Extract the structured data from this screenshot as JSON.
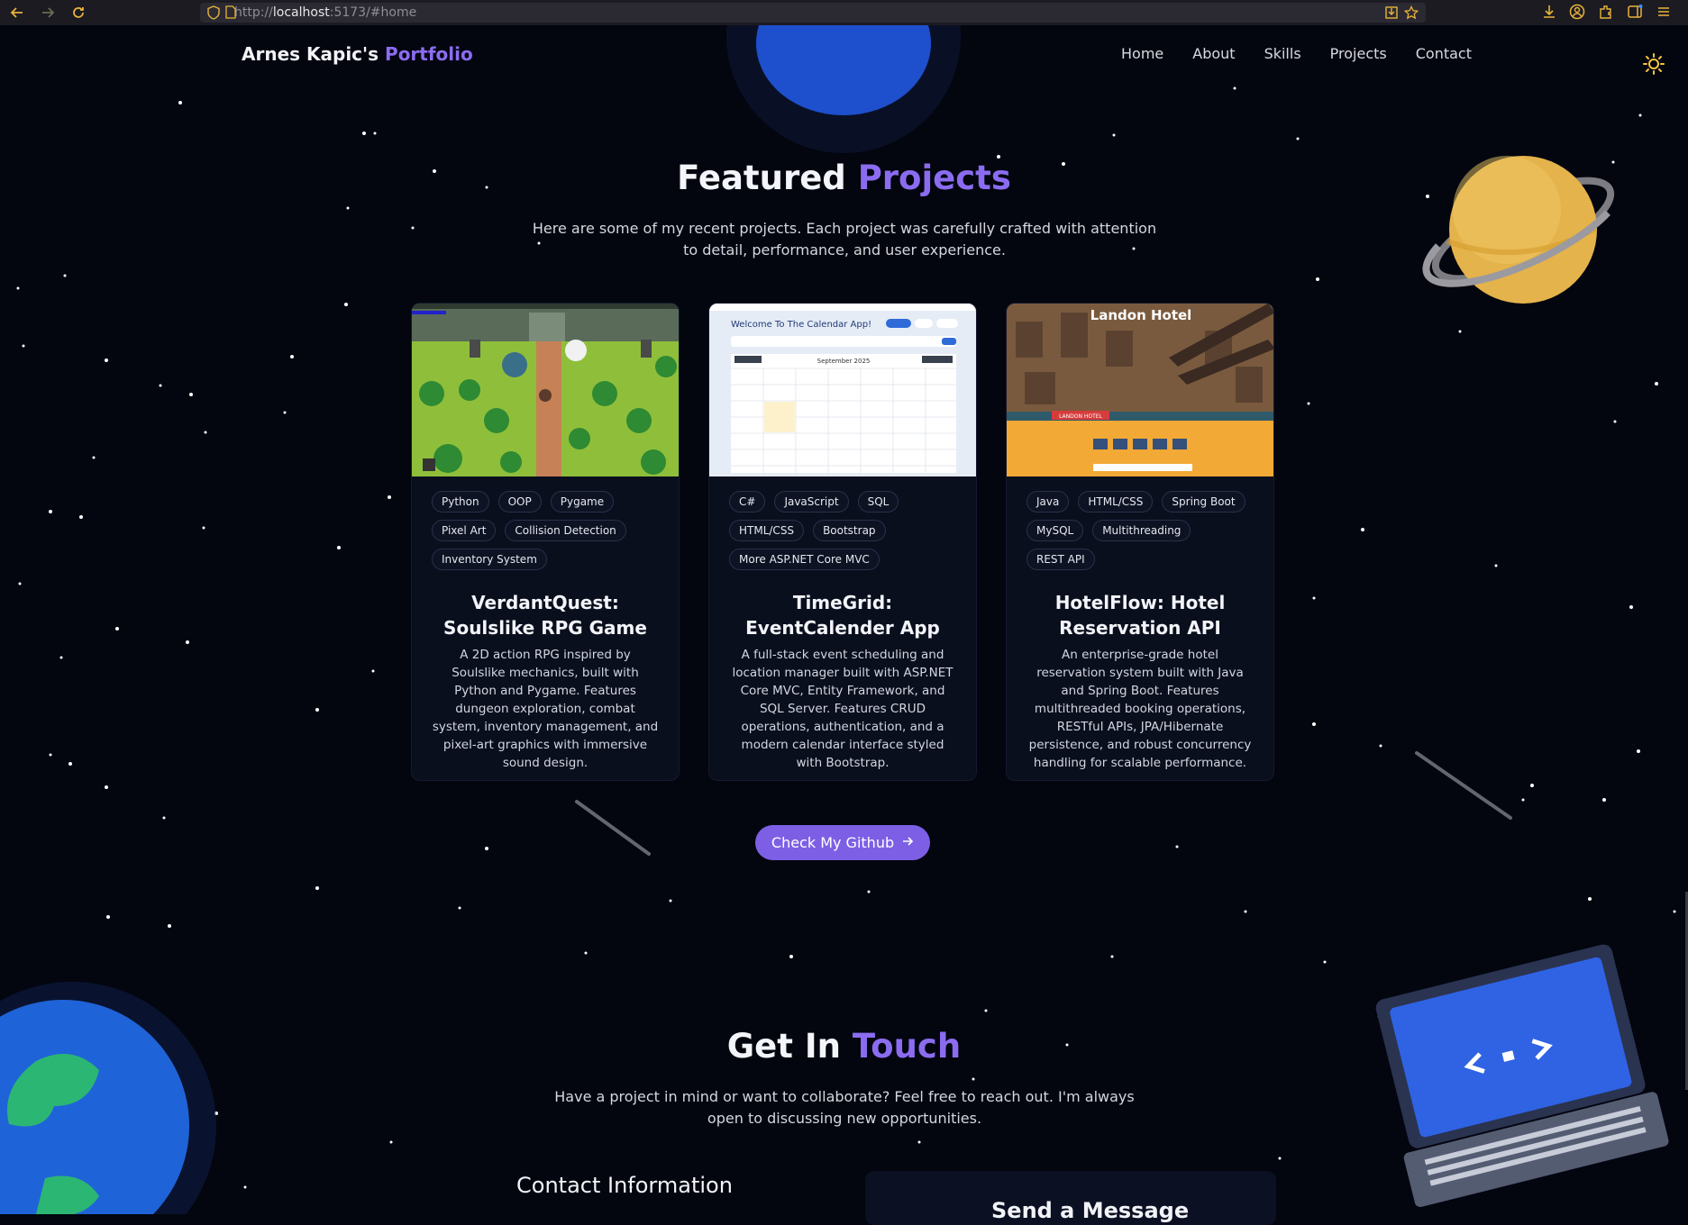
{
  "browser": {
    "url_prefix": "http://",
    "url_host": "localhost",
    "url_rest": ":5173/#home"
  },
  "header": {
    "brand_main": "Arnes Kapic's",
    "brand_accent": "Portfolio",
    "nav": [
      "Home",
      "About",
      "Skills",
      "Projects",
      "Contact"
    ]
  },
  "projects": {
    "title_main": "Featured",
    "title_accent": "Projects",
    "subtitle": "Here are some of my recent projects. Each project was carefully crafted with attention to detail, performance, and user experience.",
    "cards": [
      {
        "title": "VerdantQuest: Soulslike RPG Game",
        "tags": [
          "Python",
          "OOP",
          "Pygame",
          "Pixel Art",
          "Collision Detection",
          "Inventory System"
        ],
        "description": "A 2D action RPG inspired by Soulslike mechanics, built with Python and Pygame. Features dungeon exploration, combat system, inventory management, and pixel-art graphics with immersive sound design."
      },
      {
        "title": "TimeGrid: EventCalender App",
        "tags": [
          "C#",
          "JavaScript",
          "SQL",
          "HTML/CSS",
          "Bootstrap",
          "More ASP.NET Core MVC"
        ],
        "description": "A full-stack event scheduling and location manager built with ASP.NET Core MVC, Entity Framework, and SQL Server. Features CRUD operations, authentication, and a modern calendar interface styled with Bootstrap.",
        "screenshot_heading": "Welcome To The Calendar App!",
        "screenshot_month": "September 2025"
      },
      {
        "title": "HotelFlow: Hotel Reservation API",
        "tags": [
          "Java",
          "HTML/CSS",
          "Spring Boot",
          "MySQL",
          "Multithreading",
          "REST API"
        ],
        "description": "An enterprise-grade hotel reservation system built with Java and Spring Boot. Features multithreaded booking operations, RESTful APIs, JPA/Hibernate persistence, and robust concurrency handling for scalable performance.",
        "screenshot_heading": "Landon Hotel",
        "screenshot_banner": "LANDON HOTEL"
      }
    ],
    "cta_label": "Check My Github"
  },
  "contact": {
    "title_main": "Get In",
    "title_accent": "Touch",
    "subtitle": "Have a project in mind or want to collaborate? Feel free to reach out. I'm always open to discussing new opportunities.",
    "info_title": "Contact Information",
    "form_title": "Send a Message"
  },
  "colors": {
    "accent": "#8b6cf0",
    "button": "#7d5fe6",
    "background": "#03060f",
    "card": "#0a0f1e"
  },
  "icons": [
    "back-icon",
    "forward-icon",
    "reload-icon",
    "shield-icon",
    "page-icon",
    "save-page-icon",
    "bookmark-star-icon",
    "download-icon",
    "account-icon",
    "extensions-icon",
    "sidebar-icon",
    "menu-icon",
    "sun-icon",
    "external-link-icon",
    "github-icon",
    "arrow-right-icon"
  ]
}
